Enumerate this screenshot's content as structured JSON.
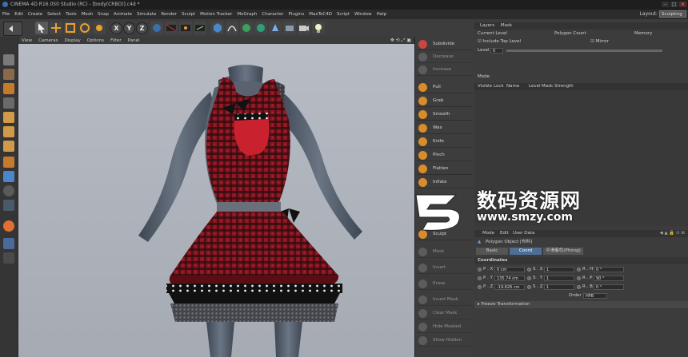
{
  "titlebar": {
    "title": "CINEMA 4D R16.050 Studio (RC) - [body(CRBO)].c4d *"
  },
  "menu": {
    "items": [
      "File",
      "Edit",
      "Create",
      "Select",
      "Tools",
      "Mesh",
      "Snap",
      "Animate",
      "Simulate",
      "Render",
      "Sculpt",
      "Motion Tracker",
      "MoGraph",
      "Character",
      "Plugins",
      "MaxToC4D",
      "Script",
      "Window",
      "Help"
    ],
    "layout_label": "Layout:",
    "layout_value": "Sculpting"
  },
  "toolbar": {
    "axis_x": "X",
    "axis_y": "Y",
    "axis_z": "Z"
  },
  "viewport": {
    "menu": [
      "View",
      "Cameras",
      "Display",
      "Options",
      "Filter",
      "Panel"
    ]
  },
  "brushes": {
    "subdivide": "Subdivide",
    "decrease": "Decrease",
    "increase": "Increase",
    "items": [
      "Pull",
      "Grab",
      "Smooth",
      "Wax",
      "Knife",
      "Pinch",
      "Flatten",
      "Inflate"
    ],
    "sculpt": "Sculpt",
    "disabled": [
      "Mask",
      "Invert",
      "Erase",
      "Invert Mask",
      "Clear Mask",
      "Hide Masked",
      "Show Hidden"
    ]
  },
  "layers": {
    "tabs": [
      "Layers",
      "Mask"
    ],
    "col_current": "Current Level",
    "col_poly": "Polygon Count",
    "col_memory": "Memory",
    "include_top": "Include Top Level",
    "mirror": "Mirror",
    "level_label": "Level",
    "level_value": "0",
    "mode_label": "Mode",
    "list_cols": [
      "Visible",
      "Lock",
      "Name",
      "Level",
      "Mask",
      "Strength"
    ]
  },
  "attributes": {
    "menu": [
      "Mode",
      "Edit",
      "User Data"
    ],
    "object": "Polygon Object [布料]",
    "tabs": [
      "Basic",
      "Coord",
      "Phong"
    ],
    "tab_phong_label": "平滑着色(Phong)",
    "section": "Coordinates",
    "coords": [
      {
        "axis": "P . X",
        "value": "0 cm",
        "saxis": "S . X",
        "svalue": "1",
        "raxis": "R . H",
        "rvalue": "0 °"
      },
      {
        "axis": "P . Y",
        "value": "135.74 cm",
        "saxis": "S . Y",
        "svalue": "1",
        "raxis": "R . P",
        "rvalue": "90 °"
      },
      {
        "axis": "P . Z",
        "value": "-19.626 cm",
        "saxis": "S . Z",
        "svalue": "1",
        "raxis": "R . B",
        "rvalue": "0 °"
      }
    ],
    "order_label": "Order",
    "order_value": "HPB",
    "freeze": "▸ Freeze Transformation"
  },
  "watermark": {
    "title": "数码资源网",
    "url": "www.smzy.com"
  },
  "colors": {
    "plaid": "#8e1620",
    "accent": "#4d6f94",
    "brush_orange": "#d98c2a"
  }
}
